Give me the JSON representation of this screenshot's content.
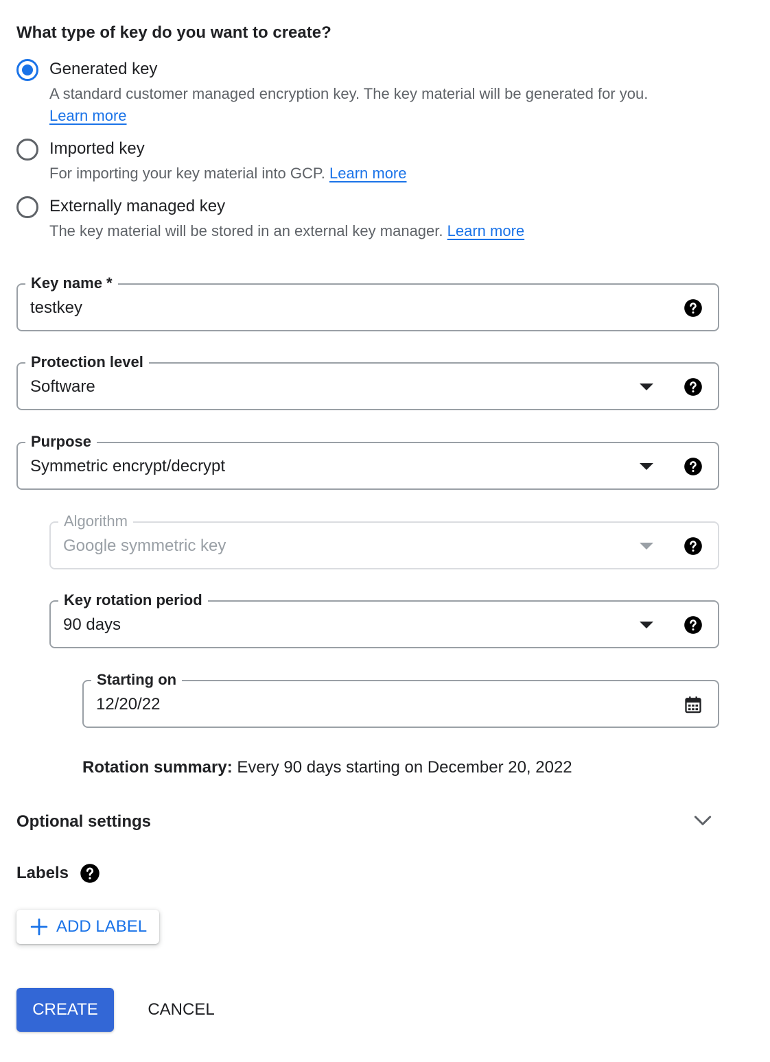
{
  "key_type": {
    "title": "What type of key do you want to create?",
    "options": [
      {
        "label": "Generated key",
        "description": "A standard customer managed encryption key. The key material will be generated for you.",
        "link": "Learn more",
        "selected": true
      },
      {
        "label": "Imported key",
        "description": "For importing your key material into GCP.",
        "link": "Learn more",
        "selected": false
      },
      {
        "label": "Externally managed key",
        "description": "The key material will be stored in an external key manager.",
        "link": "Learn more",
        "selected": false
      }
    ]
  },
  "fields": {
    "key_name": {
      "label": "Key name *",
      "value": "testkey"
    },
    "protection_level": {
      "label": "Protection level",
      "value": "Software"
    },
    "purpose": {
      "label": "Purpose",
      "value": "Symmetric encrypt/decrypt"
    },
    "algorithm": {
      "label": "Algorithm",
      "value": "Google symmetric key",
      "disabled": true
    },
    "rotation_period": {
      "label": "Key rotation period",
      "value": "90 days"
    },
    "starting_on": {
      "label": "Starting on",
      "value": "12/20/22"
    }
  },
  "rotation_summary": {
    "label": "Rotation summary:",
    "text": " Every 90 days starting on December 20, 2022"
  },
  "optional_settings": {
    "label": "Optional settings",
    "icon": "chevron-down-icon"
  },
  "labels_section": {
    "title": "Labels",
    "add_button": "ADD LABEL"
  },
  "actions": {
    "create": "CREATE",
    "cancel": "CANCEL"
  },
  "colors": {
    "accent": "#1a73e8",
    "primary_button": "#3367d6",
    "text": "#202124",
    "secondary_text": "#5f6368",
    "disabled": "#9aa0a6"
  }
}
